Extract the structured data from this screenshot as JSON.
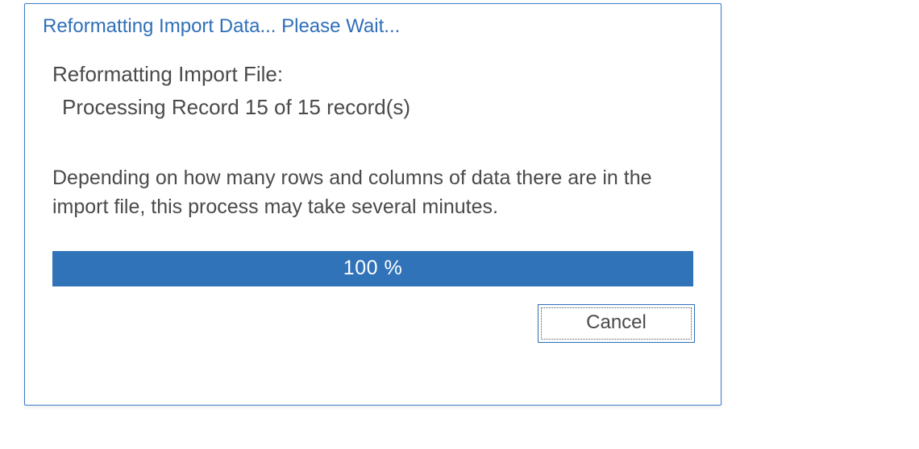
{
  "dialog": {
    "title": "Reformatting Import Data... Please Wait...",
    "heading": "Reformatting Import File:",
    "status": "Processing Record 15 of 15 record(s)",
    "info": "Depending on how many rows and columns of data there are in the import file, this process may take several minutes.",
    "progress_label": "100 %",
    "progress_value": 100,
    "cancel_label": "Cancel"
  }
}
